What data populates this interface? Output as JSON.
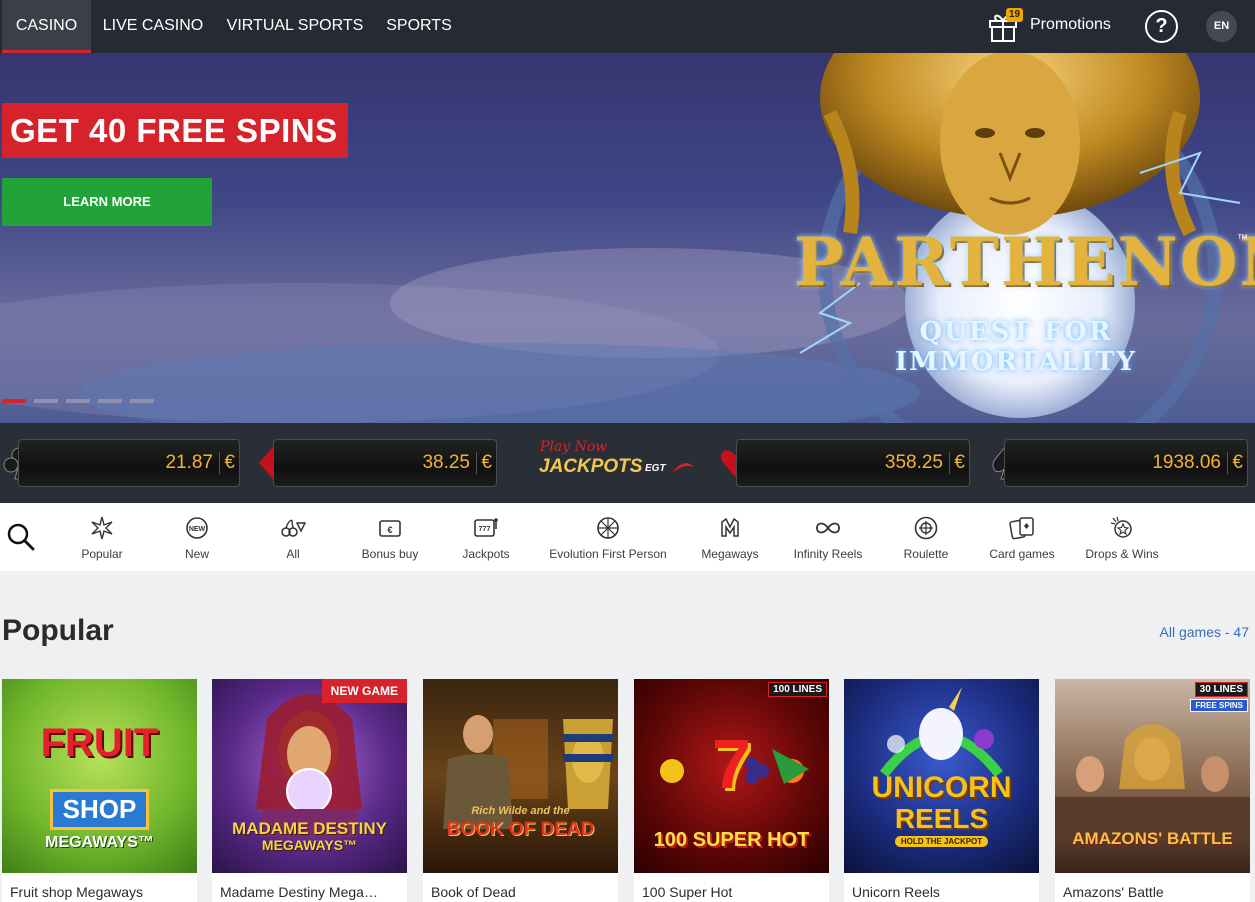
{
  "nav": {
    "tabs": [
      {
        "label": "CASINO",
        "active": true
      },
      {
        "label": "LIVE CASINO",
        "active": false
      },
      {
        "label": "VIRTUAL SPORTS",
        "active": false
      },
      {
        "label": "SPORTS",
        "active": false
      }
    ],
    "promotions_label": "Promotions",
    "promotions_count": "19",
    "help_label": "?",
    "language": "EN"
  },
  "hero": {
    "promo_title": "GET 40 FREE SPINS",
    "cta_label": "LEARN MORE",
    "brand_title": "PARTHENON",
    "brand_tm": "™",
    "brand_subtitle": "QUEST FOR IMMORTALITY",
    "slides_total": 5,
    "active_slide": 1
  },
  "jackpots": {
    "logo_top": "Play Now",
    "logo_main": "JACKPOTS",
    "logo_brand": "EGT",
    "items": [
      {
        "suit": "club-icon",
        "amount": "21.87",
        "currency": "€"
      },
      {
        "suit": "diamond-icon",
        "amount": "38.25",
        "currency": "€"
      },
      {
        "suit": "heart-icon",
        "amount": "358.25",
        "currency": "€"
      },
      {
        "suit": "spade-icon",
        "amount": "1938.06",
        "currency": "€"
      }
    ]
  },
  "categories": [
    {
      "label": "Popular",
      "icon": "star-burst-icon"
    },
    {
      "label": "New",
      "icon": "new-badge-icon"
    },
    {
      "label": "All",
      "icon": "cherries-diamond-icon"
    },
    {
      "label": "Bonus buy",
      "icon": "wallet-euro-icon"
    },
    {
      "label": "Jackpots",
      "icon": "slot-777-icon"
    },
    {
      "label": "Evolution First Person",
      "icon": "wheel-icon"
    },
    {
      "label": "Megaways",
      "icon": "megaways-icon"
    },
    {
      "label": "Infinity Reels",
      "icon": "infinity-icon"
    },
    {
      "label": "Roulette",
      "icon": "roulette-icon"
    },
    {
      "label": "Card games",
      "icon": "playing-cards-icon"
    },
    {
      "label": "Drops & Wins",
      "icon": "drops-wins-icon"
    }
  ],
  "popular": {
    "title": "Popular",
    "all_games_label": "All games - 47",
    "games": [
      {
        "name": "Fruit shop Megaways",
        "art_line1": "FRUIT",
        "art_line2": "SHOP",
        "art_line3": "MEGAWAYS™",
        "badge": ""
      },
      {
        "name": "Madame Destiny Mega…",
        "art_line1": "MADAME DESTINY",
        "art_line2": "MEGAWAYS™",
        "art_line3": "",
        "badge": "NEW GAME"
      },
      {
        "name": "Book of Dead",
        "art_line1": "Rich Wilde and the",
        "art_line2": "BOOK OF DEAD",
        "art_line3": "",
        "badge": ""
      },
      {
        "name": "100 Super Hot",
        "art_line1": "7",
        "art_line2": "100 SUPER HOT",
        "art_line3": "",
        "badge": "100 LINES"
      },
      {
        "name": "Unicorn Reels",
        "art_line1": "UNICORN",
        "art_line2": "REELS",
        "art_line3": "HOLD THE JACKPOT",
        "badge": ""
      },
      {
        "name": "Amazons' Battle",
        "art_line1": "AMAZONS' BATTLE",
        "art_line2": "",
        "art_line3": "",
        "badge": "30 LINES",
        "badge2": "FREE SPINS"
      }
    ]
  }
}
